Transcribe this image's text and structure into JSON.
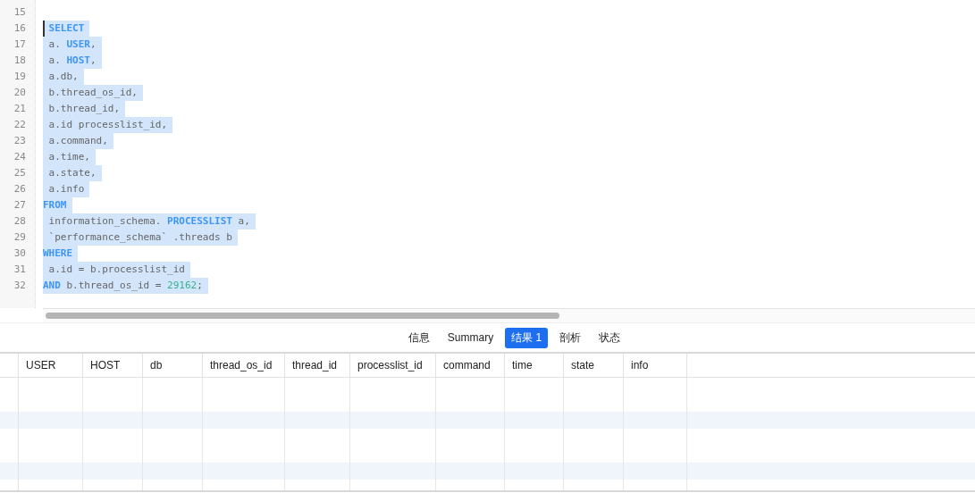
{
  "editor": {
    "lines": [
      {
        "number": "15",
        "selected": false,
        "cursor": false
      },
      {
        "number": "16",
        "selected": true,
        "cursor": true,
        "tokens": [
          {
            "kind": "keyword",
            "text": " SELECT"
          }
        ]
      },
      {
        "number": "17",
        "selected": true,
        "cursor": false,
        "tokens": [
          {
            "kind": "plain",
            "text": " a. "
          },
          {
            "kind": "keyword",
            "text": "USER"
          },
          {
            "kind": "plain",
            "text": ","
          }
        ]
      },
      {
        "number": "18",
        "selected": true,
        "cursor": false,
        "tokens": [
          {
            "kind": "plain",
            "text": " a. "
          },
          {
            "kind": "keyword",
            "text": "HOST"
          },
          {
            "kind": "plain",
            "text": ","
          }
        ]
      },
      {
        "number": "19",
        "selected": true,
        "cursor": false,
        "tokens": [
          {
            "kind": "plain",
            "text": " a.db,"
          }
        ]
      },
      {
        "number": "20",
        "selected": true,
        "cursor": false,
        "tokens": [
          {
            "kind": "plain",
            "text": " b.thread_os_id,"
          }
        ]
      },
      {
        "number": "21",
        "selected": true,
        "cursor": false,
        "tokens": [
          {
            "kind": "plain",
            "text": " b.thread_id,"
          }
        ]
      },
      {
        "number": "22",
        "selected": true,
        "cursor": false,
        "tokens": [
          {
            "kind": "plain",
            "text": " a.id processlist_id,"
          }
        ]
      },
      {
        "number": "23",
        "selected": true,
        "cursor": false,
        "tokens": [
          {
            "kind": "plain",
            "text": " a.command,"
          }
        ]
      },
      {
        "number": "24",
        "selected": true,
        "cursor": false,
        "tokens": [
          {
            "kind": "plain",
            "text": " a.time,"
          }
        ]
      },
      {
        "number": "25",
        "selected": true,
        "cursor": false,
        "tokens": [
          {
            "kind": "plain",
            "text": " a.state,"
          }
        ]
      },
      {
        "number": "26",
        "selected": true,
        "cursor": false,
        "tokens": [
          {
            "kind": "plain",
            "text": " a.info"
          }
        ]
      },
      {
        "number": "27",
        "selected": true,
        "cursor": false,
        "tokens": [
          {
            "kind": "keyword",
            "text": "FROM"
          }
        ]
      },
      {
        "number": "28",
        "selected": true,
        "cursor": false,
        "tokens": [
          {
            "kind": "plain",
            "text": " information_schema. "
          },
          {
            "kind": "keyword",
            "text": "PROCESSLIST"
          },
          {
            "kind": "plain",
            "text": " a,"
          }
        ]
      },
      {
        "number": "29",
        "selected": true,
        "cursor": false,
        "tokens": [
          {
            "kind": "plain",
            "text": " `performance_schema` .threads b"
          }
        ]
      },
      {
        "number": "30",
        "selected": true,
        "cursor": false,
        "tokens": [
          {
            "kind": "keyword",
            "text": "WHERE"
          }
        ]
      },
      {
        "number": "31",
        "selected": true,
        "cursor": false,
        "tokens": [
          {
            "kind": "plain",
            "text": " a.id = b.processlist_id"
          }
        ]
      },
      {
        "number": "32",
        "selected": true,
        "cursor": false,
        "tokens": [
          {
            "kind": "keyword",
            "text": "AND"
          },
          {
            "kind": "plain",
            "text": " b.thread_os_id = "
          },
          {
            "kind": "number",
            "text": "29162"
          },
          {
            "kind": "plain",
            "text": ";"
          }
        ]
      }
    ]
  },
  "result_tabs": [
    {
      "label": "信息",
      "selected": false
    },
    {
      "label": "Summary",
      "selected": false
    },
    {
      "label": "结果 1",
      "selected": true
    },
    {
      "label": "剖析",
      "selected": false
    },
    {
      "label": "状态",
      "selected": false
    }
  ],
  "table": {
    "columns": [
      "USER",
      "HOST",
      "db",
      "thread_os_id",
      "thread_id",
      "processlist_id",
      "command",
      "time",
      "state",
      "info"
    ]
  }
}
